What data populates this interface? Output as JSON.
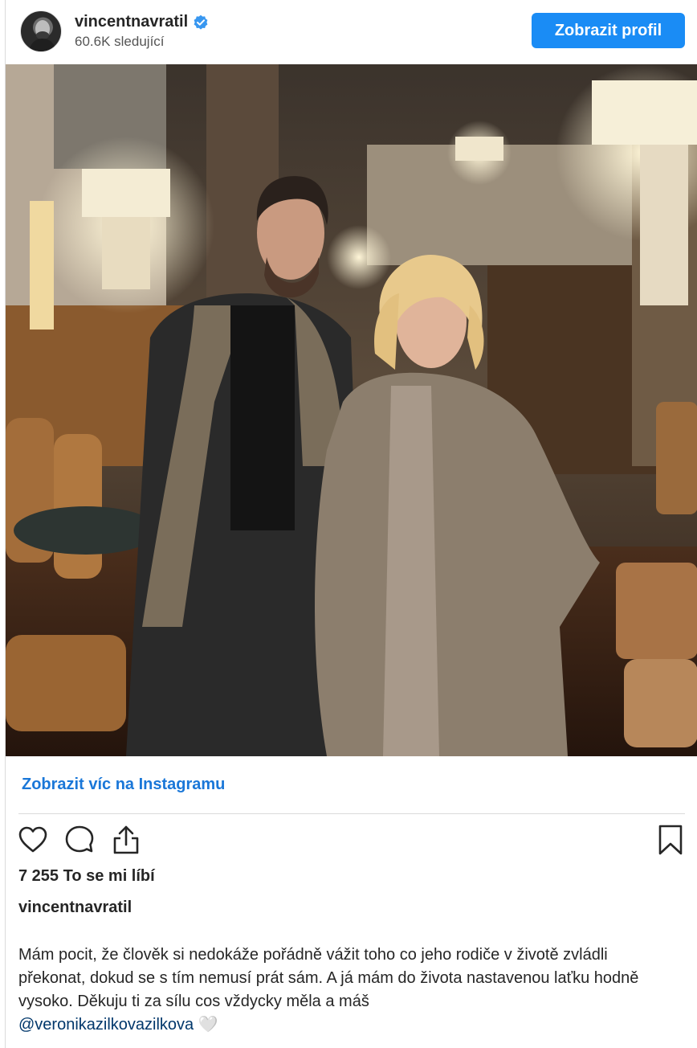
{
  "header": {
    "username": "vincentnavratil",
    "followers": "60.6K sledující",
    "view_profile_label": "Zobrazit profil",
    "avatar_icon": "avatar",
    "verified_icon": "verified-badge-icon"
  },
  "colors": {
    "accent": "#1a8cf5",
    "link": "#1a77d8",
    "mention": "#00376b",
    "text": "#262626"
  },
  "post": {
    "image_alt": "photo",
    "view_more_label": "Zobrazit víc na Instagramu",
    "actions": {
      "like_icon": "heart-icon",
      "comment_icon": "comment-icon",
      "share_icon": "share-icon",
      "save_icon": "bookmark-icon"
    },
    "likes": "7 255 To se mi líbí",
    "author": "vincentnavratil",
    "caption_text": "Mám pocit, že člověk si nedokáže pořádně vážit toho co jeho rodiče v životě zvládli překonat, dokud se s tím nemusí prát sám. A já mám do života nastavenou laťku hodně vysoko. Děkuju ti za sílu cos vždycky měla a máš",
    "mention": "@veronikazilkovazilkova",
    "emoji": "🤍"
  }
}
